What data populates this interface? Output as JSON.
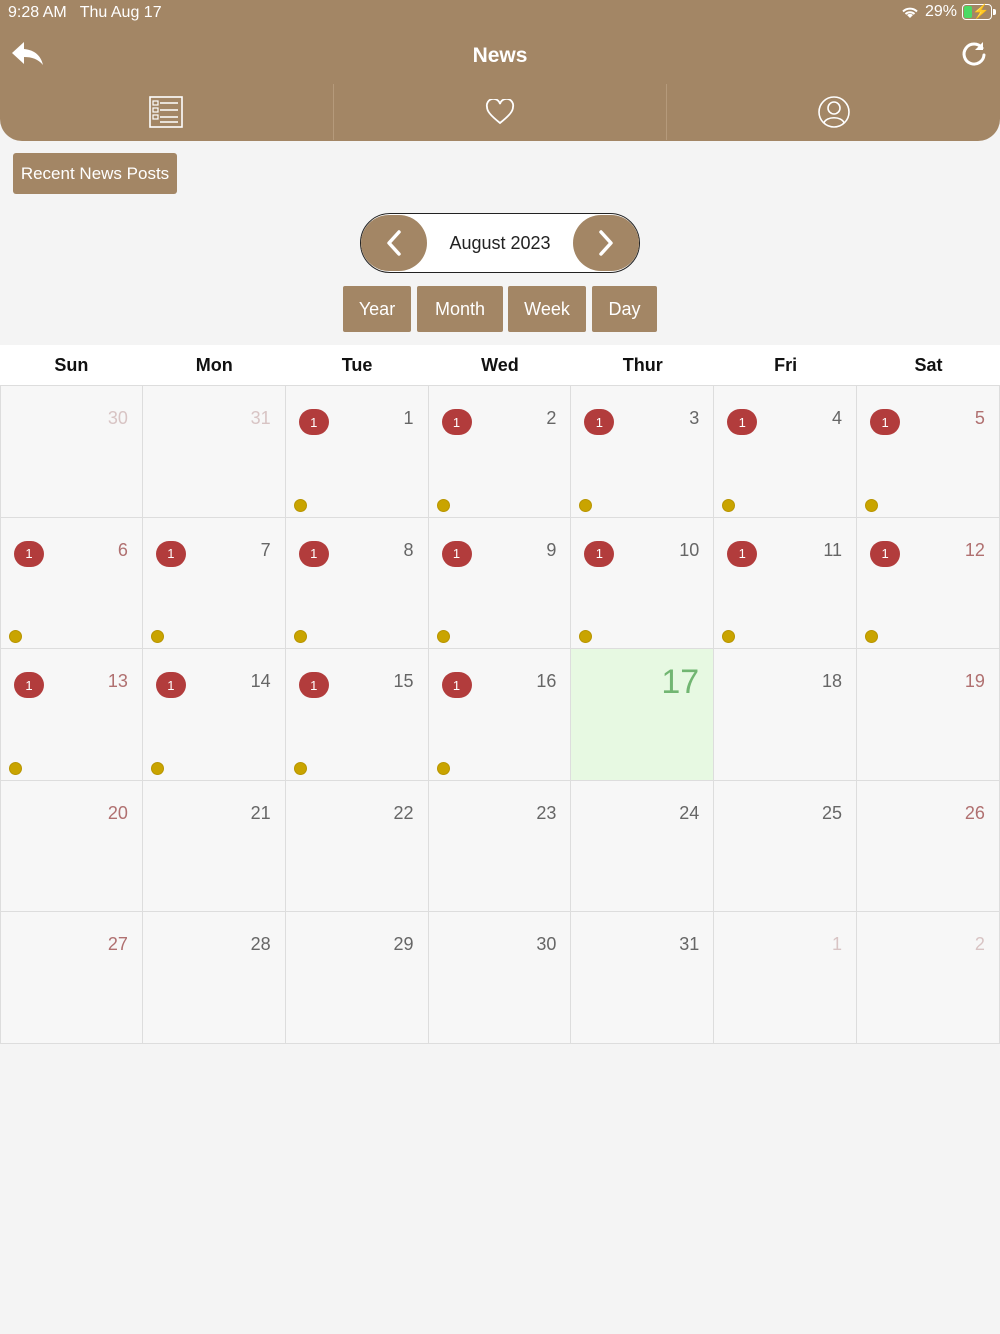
{
  "status": {
    "time_date": "9:28 AM   Thu Aug 17",
    "battery": "29%"
  },
  "header": {
    "title": "News"
  },
  "tabs": [
    {
      "icon": "list-icon"
    },
    {
      "icon": "heart-icon"
    },
    {
      "icon": "user-icon"
    }
  ],
  "recent_button": "Recent News Posts",
  "calendar": {
    "month_label": "August 2023",
    "views": [
      "Year",
      "Month",
      "Week",
      "Day"
    ],
    "weekdays": [
      "Sun",
      "Mon",
      "Tue",
      "Wed",
      "Thur",
      "Fri",
      "Sat"
    ],
    "weeks": [
      [
        {
          "day": "30",
          "other": true
        },
        {
          "day": "31",
          "other": true
        },
        {
          "day": "1",
          "count": "1"
        },
        {
          "day": "2",
          "count": "1"
        },
        {
          "day": "3",
          "count": "1"
        },
        {
          "day": "4",
          "count": "1"
        },
        {
          "day": "5",
          "count": "1"
        }
      ],
      [
        {
          "day": "6",
          "count": "1"
        },
        {
          "day": "7",
          "count": "1"
        },
        {
          "day": "8",
          "count": "1"
        },
        {
          "day": "9",
          "count": "1"
        },
        {
          "day": "10",
          "count": "1"
        },
        {
          "day": "11",
          "count": "1"
        },
        {
          "day": "12",
          "count": "1"
        }
      ],
      [
        {
          "day": "13",
          "count": "1"
        },
        {
          "day": "14",
          "count": "1"
        },
        {
          "day": "15",
          "count": "1"
        },
        {
          "day": "16",
          "count": "1"
        },
        {
          "day": "17",
          "today": true
        },
        {
          "day": "18"
        },
        {
          "day": "19"
        }
      ],
      [
        {
          "day": "20"
        },
        {
          "day": "21"
        },
        {
          "day": "22"
        },
        {
          "day": "23"
        },
        {
          "day": "24"
        },
        {
          "day": "25"
        },
        {
          "day": "26"
        }
      ],
      [
        {
          "day": "27"
        },
        {
          "day": "28"
        },
        {
          "day": "29"
        },
        {
          "day": "30"
        },
        {
          "day": "31"
        },
        {
          "day": "1",
          "other": true
        },
        {
          "day": "2",
          "other": true
        }
      ]
    ]
  },
  "colors": {
    "brand": "#a38665",
    "badge": "#b23c3c",
    "dot": "#c9a400",
    "today_bg": "#e7f9e2"
  }
}
